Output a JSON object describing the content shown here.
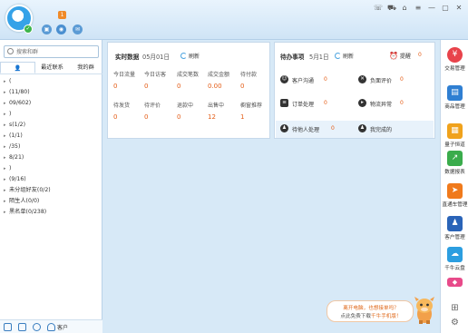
{
  "topbar": {
    "badge_count": "1",
    "window_controls": [
      "☏",
      "🛒",
      "⌂",
      "≡",
      "—",
      "▢",
      "✕"
    ]
  },
  "left": {
    "search_placeholder": "搜索和群",
    "tabs": [
      "",
      "最近联系",
      "我的群"
    ],
    "groups": [
      "(",
      "(11/80)",
      "09/602)",
      ")",
      "s(1/2)",
      "(1/1)",
      "/35)",
      "8/21)",
      ")",
      "(9/16)",
      "未分组好友(0/2)",
      "陌生人(0/0)",
      "黑名单(0/238)"
    ],
    "bottom_label": "客户"
  },
  "realtime": {
    "title": "实时数据",
    "date": "05月01日",
    "refresh": "刷新",
    "stats": [
      {
        "label": "今日流量",
        "value": "0"
      },
      {
        "label": "今日访客",
        "value": "0"
      },
      {
        "label": "成交笔数",
        "value": "0"
      },
      {
        "label": "成交金额",
        "value": "0.00"
      },
      {
        "label": "待付款",
        "value": "0"
      },
      {
        "label": "待发货",
        "value": "0"
      },
      {
        "label": "待评价",
        "value": "0"
      },
      {
        "label": "退款中",
        "value": "0"
      },
      {
        "label": "出售中",
        "value": "12"
      },
      {
        "label": "橱窗推荐",
        "value": "1"
      }
    ]
  },
  "todo": {
    "title": "待办事项",
    "date": "5月1日",
    "refresh": "刷新",
    "reminder": "提醒",
    "reminder_value": "0",
    "items": [
      {
        "label": "客户沟通",
        "value": "0"
      },
      {
        "label": "负面评价",
        "value": "0"
      },
      {
        "label": "订单处理",
        "value": "0"
      },
      {
        "label": "物流异常",
        "value": "0"
      },
      {
        "label": "待他人处理",
        "value": "0"
      },
      {
        "label": "我完成的",
        "value": ""
      }
    ]
  },
  "sidebar": {
    "items": [
      {
        "label": "交易管理",
        "icon": "trade-icon",
        "color": "#e8434b"
      },
      {
        "label": "商品管理",
        "icon": "goods-icon",
        "color": "#2f7fd2"
      },
      {
        "label": "量子恒道",
        "icon": "chart-icon",
        "color": "#f0a21c"
      },
      {
        "label": "数据报表",
        "icon": "report-icon",
        "color": "#3aac4c"
      },
      {
        "label": "直通车管理",
        "icon": "car-icon",
        "color": "#f07a1c"
      },
      {
        "label": "客户管理",
        "icon": "customer-icon",
        "color": "#2a64b8"
      },
      {
        "label": "千牛云盘",
        "icon": "cloud-icon",
        "color": "#2c9ee0"
      }
    ]
  },
  "bubble": {
    "line1": "离开电脑，也想接单吗？",
    "line2_prefix": "点此免费下载",
    "line2_highlight": "千牛手机版！"
  },
  "colors": {
    "accent": "#e45d17",
    "link": "#4aa3df"
  }
}
